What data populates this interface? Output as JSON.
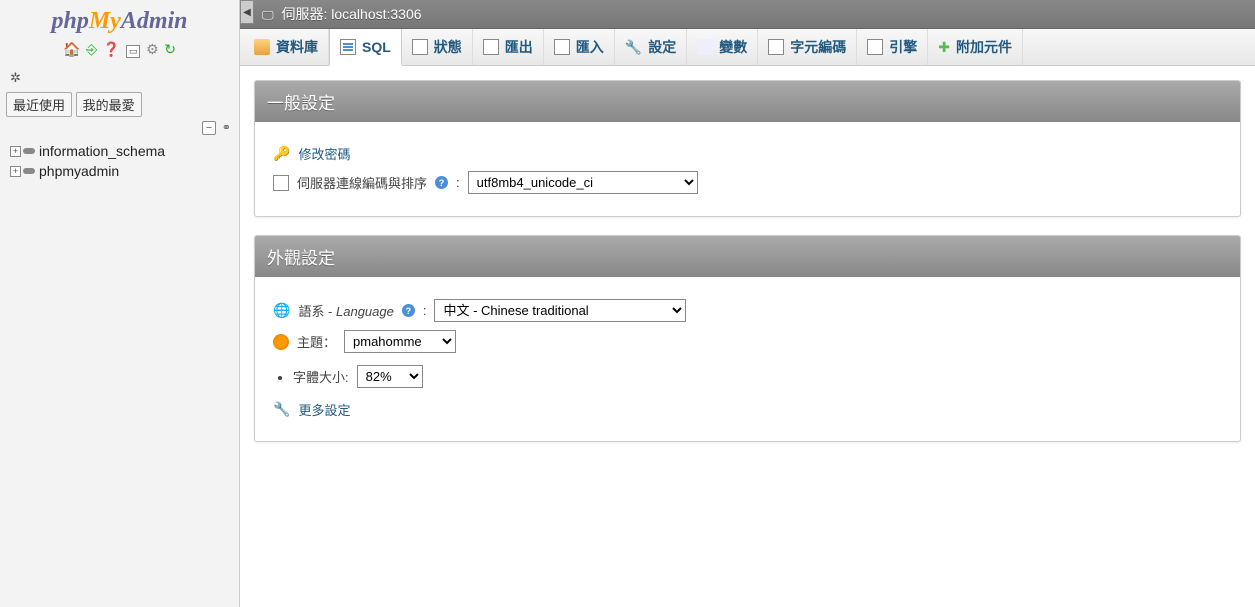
{
  "logo": {
    "php": "php",
    "my": "My",
    "admin": "Admin"
  },
  "sidebar": {
    "tabs": {
      "recent": "最近使用",
      "favorites": "我的最愛"
    },
    "databases": [
      {
        "name": "information_schema"
      },
      {
        "name": "phpmyadmin"
      }
    ]
  },
  "breadcrumb": {
    "server_label": "伺服器:",
    "server_value": "localhost:3306"
  },
  "topnav": [
    {
      "key": "databases",
      "label": "資料庫"
    },
    {
      "key": "sql",
      "label": "SQL"
    },
    {
      "key": "status",
      "label": "狀態"
    },
    {
      "key": "export",
      "label": "匯出"
    },
    {
      "key": "import",
      "label": "匯入"
    },
    {
      "key": "settings",
      "label": "設定"
    },
    {
      "key": "variables",
      "label": "變數"
    },
    {
      "key": "charsets",
      "label": "字元編碼"
    },
    {
      "key": "engines",
      "label": "引擎"
    },
    {
      "key": "plugins",
      "label": "附加元件"
    }
  ],
  "general": {
    "title": "一般設定",
    "change_password": "修改密碼",
    "collation_label": "伺服器連線編碼與排序",
    "collation_value": "utf8mb4_unicode_ci"
  },
  "appearance": {
    "title": "外觀設定",
    "language_label": "語系 - ",
    "language_label_italic": "Language",
    "language_value": "中文 - Chinese traditional",
    "theme_label": "主題：",
    "theme_value": "pmahomme",
    "fontsize_label": "字體大小:",
    "fontsize_value": "82%",
    "more_settings": "更多設定"
  }
}
